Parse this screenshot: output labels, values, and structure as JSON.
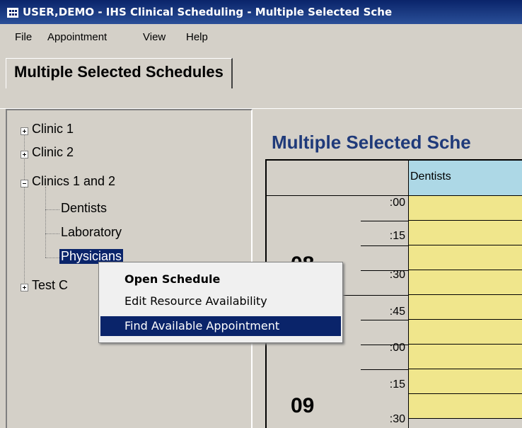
{
  "window": {
    "title": "USER,DEMO - IHS Clinical Scheduling - Multiple Selected Sche"
  },
  "menu": {
    "items": [
      "File",
      "Appointment",
      "View",
      "Help"
    ]
  },
  "tab": {
    "label": "Multiple Selected Schedules"
  },
  "tree": {
    "items": [
      "Clinic 1",
      "Clinic 2",
      "Clinics 1 and 2",
      "Dentists",
      "Laboratory",
      "Physicians",
      "Test C"
    ]
  },
  "schedule": {
    "title": "Multiple Selected Sche",
    "column_header": "Dentists",
    "hours": [
      "08",
      "09"
    ],
    "minutes": [
      ":00",
      ":15",
      ":30",
      ":45",
      ":00",
      ":15",
      ":30"
    ]
  },
  "context_menu": {
    "items": [
      "Open Schedule",
      "Edit Resource Availability",
      "Find Available Appointment"
    ]
  },
  "colors": {
    "title_bar": "#0a246a",
    "selection": "#0a246a",
    "slot": "#f0e68c",
    "header": "#add8e6"
  }
}
